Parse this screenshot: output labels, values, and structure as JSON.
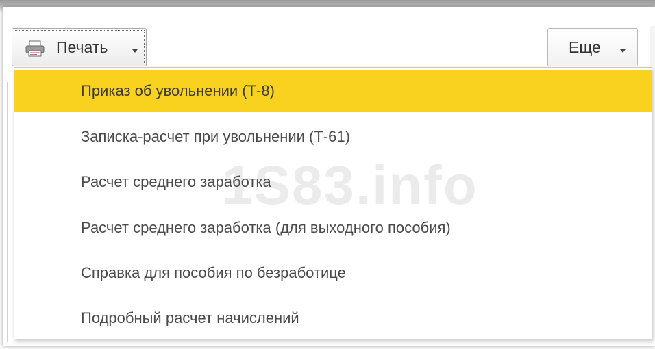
{
  "toolbar": {
    "print_label": "Печать",
    "more_label": "Еще"
  },
  "menu": {
    "items": [
      {
        "label": "Приказ об увольнении (Т-8)",
        "active": true
      },
      {
        "label": "Записка-расчет при увольнении (Т-61)",
        "active": false
      },
      {
        "label": "Расчет среднего заработка",
        "active": false
      },
      {
        "label": "Расчет среднего заработка (для выходного пособия)",
        "active": false
      },
      {
        "label": "Справка для пособия по безработице",
        "active": false
      },
      {
        "label": "Подробный расчет начислений",
        "active": false
      }
    ]
  },
  "watermark": "1S83.info",
  "icons": {
    "print": "printer-icon",
    "caret": "chevron-down-icon"
  },
  "colors": {
    "highlight": "#f8d21e",
    "text": "#4a4a4a"
  }
}
